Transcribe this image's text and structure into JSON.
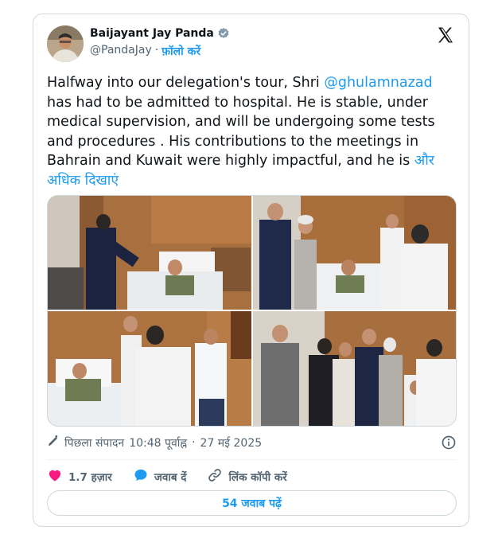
{
  "author": {
    "name": "Baijayant Jay Panda",
    "handle": "@PandaJay",
    "separator": "·",
    "follow_label": "फ़ॉलो करें"
  },
  "tweet": {
    "text_1": "Halfway into our delegation's tour, Shri ",
    "mention": "@ghulamnazad",
    "text_2": " has had to be admitted to hospital. He is stable, under medical supervision, and will be undergoing some tests and procedures . His contributions to the meetings in Bahrain and Kuwait were highly impactful, and he is ",
    "show_more": "और अधिक दिखाएं"
  },
  "meta": {
    "edited_label": "पिछला संपादन",
    "time": "10:48 पूर्वाह्न",
    "separator": "·",
    "date": "27 मई 2025"
  },
  "actions": {
    "likes": "1.7 हज़ार",
    "reply": "जवाब दें",
    "copy_link": "लिंक कॉपी करें"
  },
  "replies_button": "54 जवाब पढ़ें",
  "icons": [
    "verified-badge-icon",
    "x-logo-icon",
    "pencil-icon",
    "info-icon",
    "heart-icon",
    "reply-bubble-icon",
    "link-icon"
  ],
  "colors": {
    "accent": "#1d9bf0",
    "like": "#f91880",
    "text": "#0f1419",
    "muted": "#536471"
  }
}
